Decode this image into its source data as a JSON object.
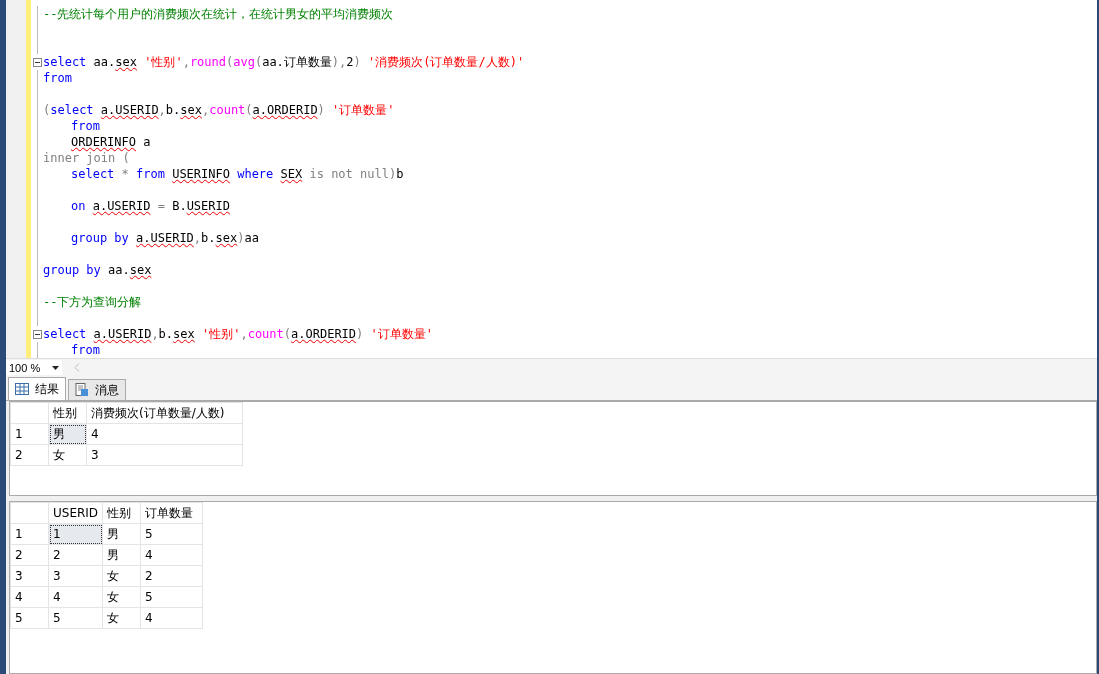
{
  "editor": {
    "lines": [
      {
        "fold": false,
        "tokens": [
          {
            "kind": "comment",
            "text": "--先统计每个用户的消费频次在统计，在统计男女的平均消费频次"
          }
        ]
      },
      {
        "fold": false
      },
      {
        "fold": false
      },
      {
        "fold": true,
        "tokens": [
          {
            "kind": "keyword",
            "text": "select"
          },
          {
            "kind": "plain",
            "text": " aa."
          },
          {
            "kind": "plain",
            "text": "sex",
            "error": true
          },
          {
            "kind": "string",
            "text": " '性别'"
          },
          {
            "kind": "op",
            "text": ","
          },
          {
            "kind": "function",
            "text": "round"
          },
          {
            "kind": "op",
            "text": "("
          },
          {
            "kind": "function",
            "text": "avg"
          },
          {
            "kind": "op",
            "text": "("
          },
          {
            "kind": "plain",
            "text": "aa.订单数量"
          },
          {
            "kind": "op",
            "text": "),"
          },
          {
            "kind": "plain",
            "text": "2"
          },
          {
            "kind": "op",
            "text": ")"
          },
          {
            "kind": "string",
            "text": " '消费频次(订单数量/人数)'"
          }
        ]
      },
      {
        "fold": false,
        "tokens": [
          {
            "kind": "keyword",
            "text": "from"
          }
        ]
      },
      {
        "fold": false
      },
      {
        "fold": false,
        "tokens": [
          {
            "kind": "op",
            "text": "("
          },
          {
            "kind": "keyword",
            "text": "select "
          },
          {
            "kind": "plain",
            "text": "a.USERID",
            "error": true
          },
          {
            "kind": "op",
            "text": ","
          },
          {
            "kind": "plain",
            "text": "b."
          },
          {
            "kind": "plain",
            "text": "sex",
            "error": true
          },
          {
            "kind": "op",
            "text": ","
          },
          {
            "kind": "function",
            "text": "count"
          },
          {
            "kind": "op",
            "text": "("
          },
          {
            "kind": "plain",
            "text": "a.ORDERID",
            "error": true
          },
          {
            "kind": "op",
            "text": ")"
          },
          {
            "kind": "string",
            "text": " '订单数量'"
          }
        ]
      },
      {
        "fold": false,
        "indent": true,
        "tokens": [
          {
            "kind": "keyword",
            "text": "from"
          }
        ]
      },
      {
        "fold": false,
        "indent": true,
        "tokens": [
          {
            "kind": "plain",
            "text": "ORDERINFO",
            "error": true
          },
          {
            "kind": "plain",
            "text": " a"
          }
        ]
      },
      {
        "fold": false,
        "tokens": [
          {
            "kind": "op",
            "text": "inner join ("
          }
        ]
      },
      {
        "fold": false,
        "indent": true,
        "tokens": [
          {
            "kind": "keyword",
            "text": "select"
          },
          {
            "kind": "op",
            "text": " * "
          },
          {
            "kind": "keyword",
            "text": "from "
          },
          {
            "kind": "plain",
            "text": "USERINFO",
            "error": true
          },
          {
            "kind": "keyword",
            "text": " where "
          },
          {
            "kind": "plain",
            "text": "SEX",
            "error": true
          },
          {
            "kind": "op",
            "text": " is not null)"
          },
          {
            "kind": "plain",
            "text": "b"
          }
        ]
      },
      {
        "fold": false
      },
      {
        "fold": false,
        "indent": true,
        "tokens": [
          {
            "kind": "keyword",
            "text": "on "
          },
          {
            "kind": "plain",
            "text": "a.USERID",
            "error": true
          },
          {
            "kind": "op",
            "text": " = "
          },
          {
            "kind": "plain",
            "text": "B."
          },
          {
            "kind": "plain",
            "text": "USERID",
            "error": true
          }
        ]
      },
      {
        "fold": false
      },
      {
        "fold": false,
        "indent": true,
        "tokens": [
          {
            "kind": "keyword",
            "text": "group by "
          },
          {
            "kind": "plain",
            "text": "a.USERID",
            "error": true
          },
          {
            "kind": "op",
            "text": ","
          },
          {
            "kind": "plain",
            "text": "b."
          },
          {
            "kind": "plain",
            "text": "sex",
            "error": true
          },
          {
            "kind": "op",
            "text": ")"
          },
          {
            "kind": "plain",
            "text": "aa"
          }
        ]
      },
      {
        "fold": false
      },
      {
        "fold": false,
        "tokens": [
          {
            "kind": "keyword",
            "text": "group by"
          },
          {
            "kind": "plain",
            "text": " aa."
          },
          {
            "kind": "plain",
            "text": "sex",
            "error": true
          }
        ]
      },
      {
        "fold": false
      },
      {
        "fold": false,
        "tokens": [
          {
            "kind": "comment",
            "text": "--下方为查询分解"
          }
        ]
      },
      {
        "fold": false
      },
      {
        "fold": true,
        "tokens": [
          {
            "kind": "keyword",
            "text": "select "
          },
          {
            "kind": "plain",
            "text": "a.USERID",
            "error": true
          },
          {
            "kind": "op",
            "text": ","
          },
          {
            "kind": "plain",
            "text": "b."
          },
          {
            "kind": "plain",
            "text": "sex",
            "error": true
          },
          {
            "kind": "string",
            "text": " '性别'"
          },
          {
            "kind": "op",
            "text": ","
          },
          {
            "kind": "function",
            "text": "count"
          },
          {
            "kind": "op",
            "text": "("
          },
          {
            "kind": "plain",
            "text": "a.ORDERID",
            "error": true
          },
          {
            "kind": "op",
            "text": ")"
          },
          {
            "kind": "string",
            "text": " '订单数量'"
          }
        ]
      },
      {
        "fold": false,
        "indent": true,
        "tokens": [
          {
            "kind": "keyword",
            "text": "from"
          }
        ]
      }
    ]
  },
  "zoom": {
    "value": "100 %"
  },
  "tabs": [
    {
      "label": "结果",
      "selected": true
    },
    {
      "label": "消息",
      "selected": false
    }
  ],
  "grids": [
    {
      "columns": [
        "性别",
        "消费频次(订单数量/人数)"
      ],
      "rows": [
        {
          "number": "1",
          "cells": [
            {
              "text": "男",
              "selected": true
            },
            {
              "text": "4",
              "selected": false
            }
          ]
        },
        {
          "number": "2",
          "cells": [
            {
              "text": "女",
              "selected": false
            },
            {
              "text": "3",
              "selected": false
            }
          ]
        }
      ]
    },
    {
      "columns": [
        "USERID",
        "性别",
        "订单数量"
      ],
      "rows": [
        {
          "number": "1",
          "cells": [
            {
              "text": "1",
              "selected": true
            },
            {
              "text": "男",
              "selected": false
            },
            {
              "text": "5",
              "selected": false
            }
          ]
        },
        {
          "number": "2",
          "cells": [
            {
              "text": "2",
              "selected": false
            },
            {
              "text": "男",
              "selected": false
            },
            {
              "text": "4",
              "selected": false
            }
          ]
        },
        {
          "number": "3",
          "cells": [
            {
              "text": "3",
              "selected": false
            },
            {
              "text": "女",
              "selected": false
            },
            {
              "text": "2",
              "selected": false
            }
          ]
        },
        {
          "number": "4",
          "cells": [
            {
              "text": "4",
              "selected": false
            },
            {
              "text": "女",
              "selected": false
            },
            {
              "text": "5",
              "selected": false
            }
          ]
        },
        {
          "number": "5",
          "cells": [
            {
              "text": "5",
              "selected": false
            },
            {
              "text": "女",
              "selected": false
            },
            {
              "text": "4",
              "selected": false
            }
          ]
        }
      ]
    }
  ]
}
